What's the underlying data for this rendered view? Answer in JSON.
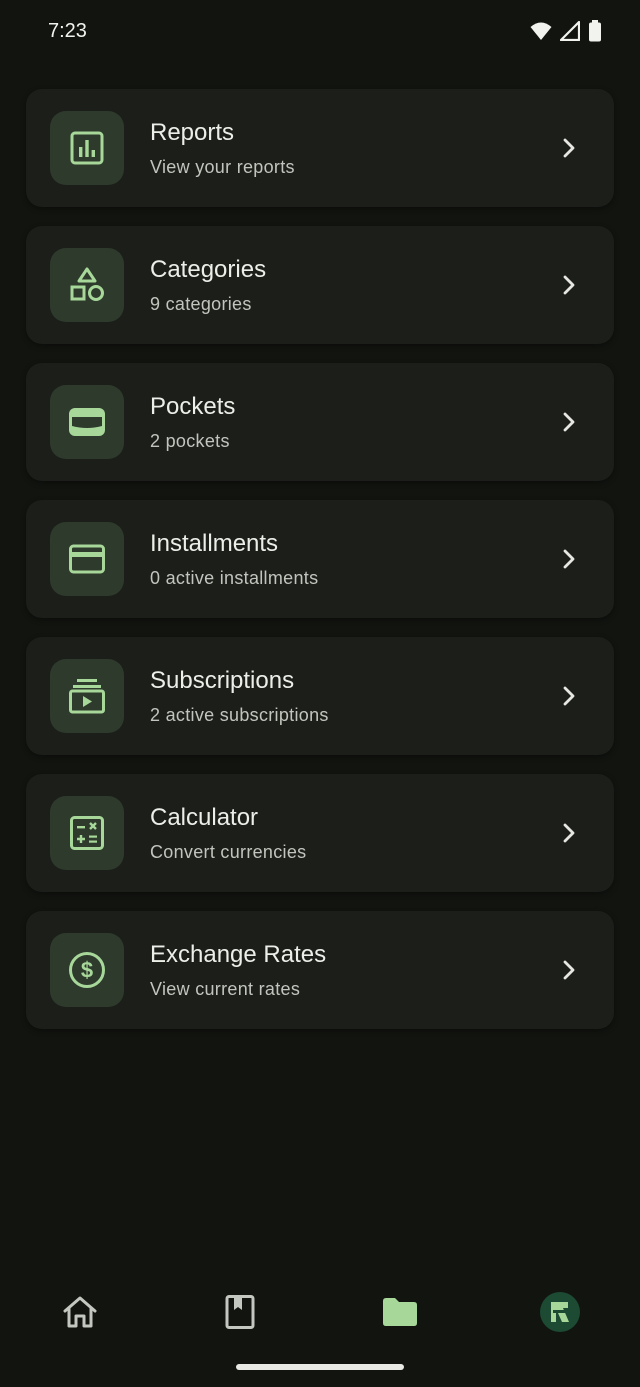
{
  "status_bar": {
    "time": "7:23"
  },
  "menu": {
    "items": [
      {
        "title": "Reports",
        "subtitle": "View your reports",
        "icon": "bar-chart-icon"
      },
      {
        "title": "Categories",
        "subtitle": "9 categories",
        "icon": "shapes-icon"
      },
      {
        "title": "Pockets",
        "subtitle": "2 pockets",
        "icon": "wallet-icon"
      },
      {
        "title": "Installments",
        "subtitle": "0 active installments",
        "icon": "credit-card-icon"
      },
      {
        "title": "Subscriptions",
        "subtitle": "2 active subscriptions",
        "icon": "subscriptions-icon"
      },
      {
        "title": "Calculator",
        "subtitle": "Convert currencies",
        "icon": "calculator-icon"
      },
      {
        "title": "Exchange Rates",
        "subtitle": "View current rates",
        "icon": "dollar-circle-icon"
      }
    ]
  },
  "bottom_nav": {
    "items": [
      {
        "icon": "home-icon",
        "active": false
      },
      {
        "icon": "bookmark-book-icon",
        "active": false
      },
      {
        "icon": "folder-icon",
        "active": true
      },
      {
        "icon": "app-logo-avatar-icon",
        "active": false
      }
    ]
  },
  "colors": {
    "background": "#121410",
    "card": "#1c1e1a",
    "icon_box": "#2e3a2c",
    "accent": "#a7d89a"
  }
}
